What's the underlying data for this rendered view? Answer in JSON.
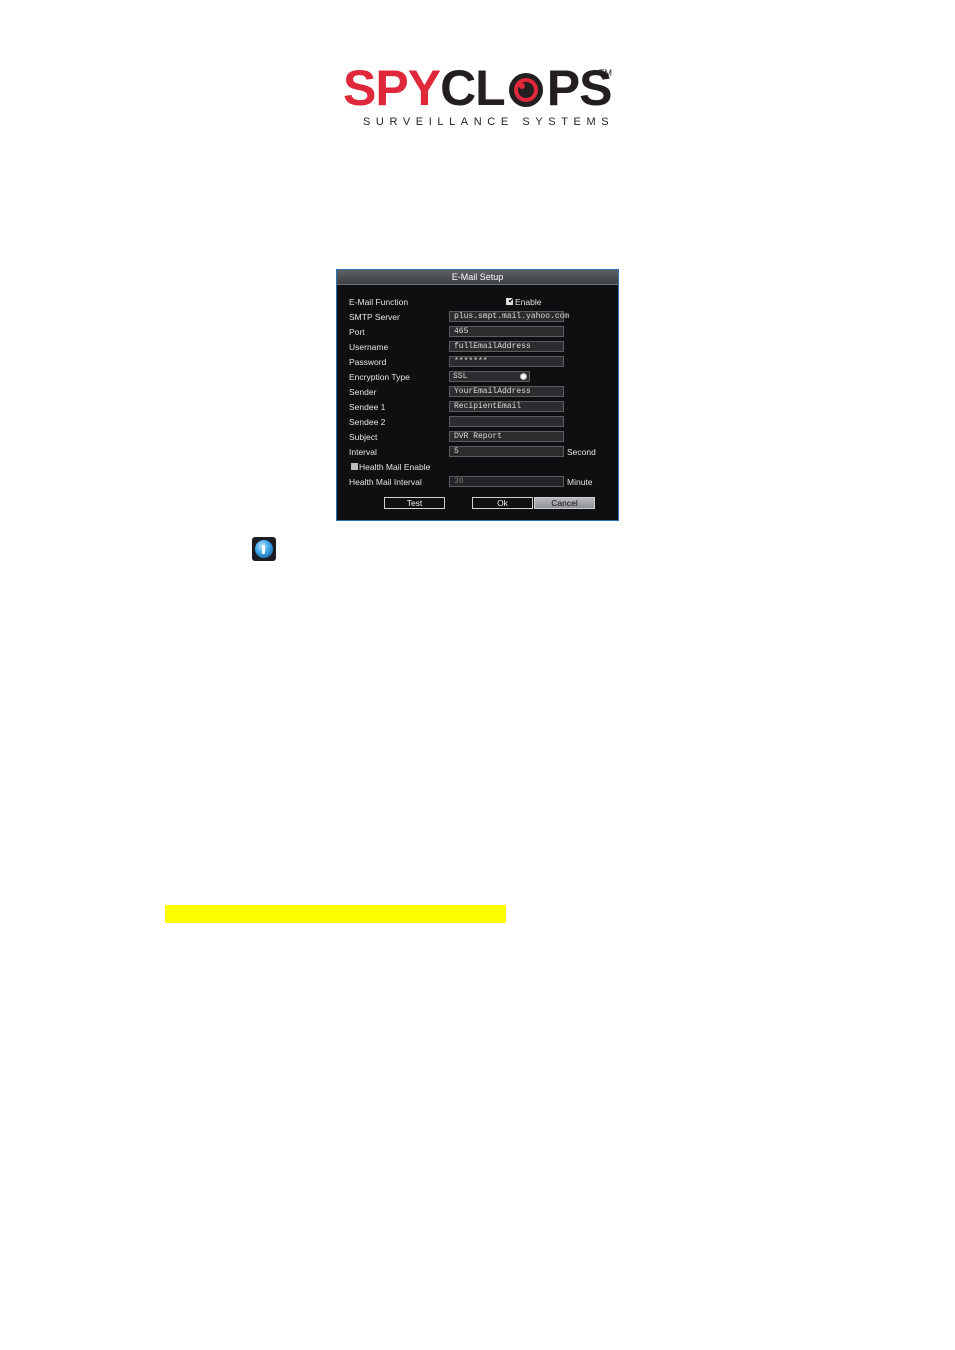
{
  "logo": {
    "brand": "SPYCLOPS",
    "tagline": "SURVEILLANCE SYSTEMS",
    "trademark": "TM",
    "colors": {
      "red": "#e0283b",
      "dark": "#231f20"
    }
  },
  "dialog": {
    "title": "E-Mail Setup",
    "email_function_label": "E-Mail Function",
    "enable_label": "Enable",
    "enable_checked": true,
    "smtp_label": "SMTP Server",
    "smtp_value": "plus.smpt.mail.yahoo.com",
    "port_label": "Port",
    "port_value": "465",
    "username_label": "Username",
    "username_value": "fullEmailAddress",
    "password_label": "Password",
    "password_value": "*******",
    "encryption_label": "Encryption Type",
    "encryption_value": "SSL",
    "sender_label": "Sender",
    "sender_value": "YourEmailAddress",
    "sendee1_label": "Sendee 1",
    "sendee1_value": "RecipientEmail",
    "sendee2_label": "Sendee 2",
    "sendee2_value": "",
    "subject_label": "Subject",
    "subject_value": "DVR Report",
    "interval_label": "Interval",
    "interval_value": "5",
    "interval_unit": "Second",
    "health_enable_label": "Health Mail Enable",
    "health_enable_checked": false,
    "health_interval_label": "Health Mail Interval",
    "health_interval_value": "30",
    "health_interval_unit": "Minute",
    "test_button": "Test",
    "ok_button": "Ok",
    "cancel_button": "Cancel"
  },
  "info_icon": "info-icon",
  "highlight_color": "#ffff00"
}
